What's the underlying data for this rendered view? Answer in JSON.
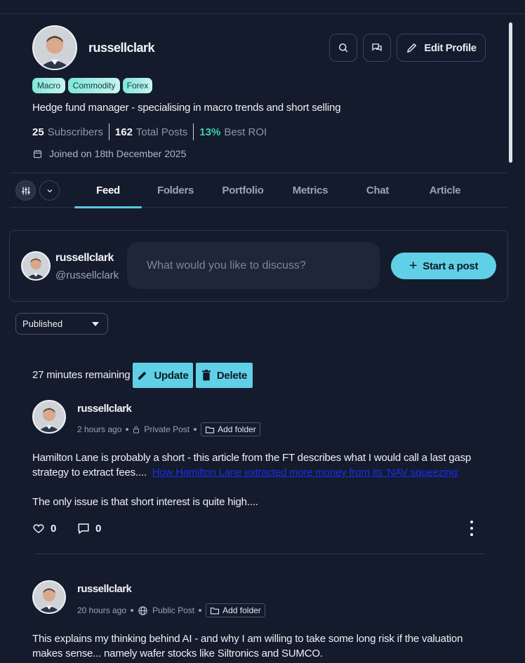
{
  "profile": {
    "username": "russellclark",
    "edit_label": "Edit Profile",
    "tags": [
      "Macro",
      "Commodity",
      "Forex"
    ],
    "bio": "Hedge fund manager - specialising in macro trends and short selling",
    "stats": {
      "subscribers_count": "25",
      "subscribers_label": "Subscribers",
      "posts_count": "162",
      "posts_label": "Total Posts",
      "roi_value": "13%",
      "roi_label": "Best ROI"
    },
    "joined": "Joined on 18th December 2025"
  },
  "tabs": [
    "Feed",
    "Folders",
    "Portfolio",
    "Metrics",
    "Chat",
    "Article"
  ],
  "composer": {
    "username": "russellclark",
    "handle": "@russellclark",
    "placeholder": "What would you like to discuss?",
    "start_label": "Start a post"
  },
  "filter": {
    "selected": "Published"
  },
  "pending": {
    "remaining": "27 minutes remaining",
    "update_label": "Update",
    "delete_label": "Delete"
  },
  "posts": [
    {
      "username": "russellclark",
      "time": "2 hours ago",
      "visibility": "Private Post",
      "folder_label": "Add folder",
      "text1": "Hamilton Lane is probably a short - this article from the FT describes what I would call a last gasp",
      "text2": "strategy to extract fees....",
      "link": "How Hamilton Lane extracted more money from its 'NAV squeezing'",
      "text3": "The only issue is that short interest is quite high....",
      "likes": "0",
      "comments": "0"
    },
    {
      "username": "russellclark",
      "time": "20 hours ago",
      "visibility": "Public Post",
      "folder_label": "Add folder",
      "text1": "This explains my thinking behind AI - and why I am willing to take some long risk if the valuation",
      "text2": "makes sense...  namely wafer stocks like Siltronics and SUMCO."
    }
  ],
  "colors": {
    "accent": "#5fd0e6",
    "background": "#141b2d",
    "roi_green": "#3fd0a8",
    "link": "#1a2cf0"
  }
}
